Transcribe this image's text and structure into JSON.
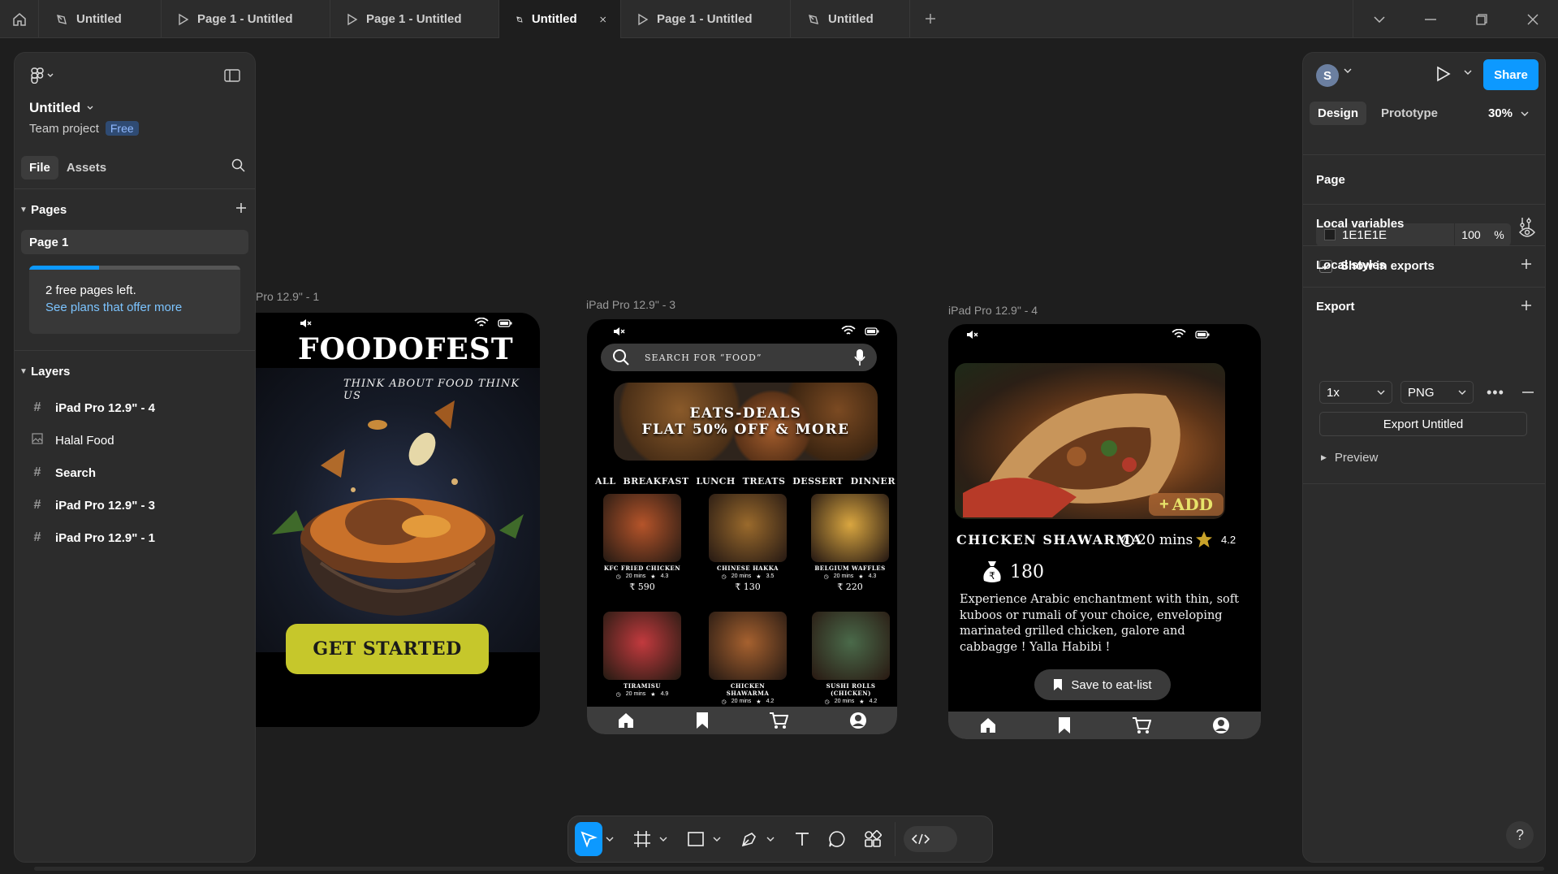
{
  "tabs": [
    {
      "label": "Untitled",
      "kind": "design",
      "active": false
    },
    {
      "label": "Page 1 - Untitled",
      "kind": "prototype",
      "active": false
    },
    {
      "label": "Page 1 - Untitled",
      "kind": "prototype",
      "active": false
    },
    {
      "label": "Untitled",
      "kind": "design",
      "active": true
    },
    {
      "label": "Page 1 - Untitled",
      "kind": "prototype",
      "active": false
    },
    {
      "label": "Untitled",
      "kind": "design",
      "active": false
    }
  ],
  "left_panel": {
    "file_title": "Untitled",
    "team": "Team project",
    "plan_badge": "Free",
    "tab_file": "File",
    "tab_assets": "Assets",
    "pages_heading": "Pages",
    "pages": [
      "Page 1"
    ],
    "upsell_line1": "2 free pages left.",
    "upsell_line2": "See plans that offer more",
    "upsell_progress": 0.33,
    "layers_heading": "Layers",
    "layers": [
      {
        "name": "iPad Pro 12.9\" - 4",
        "icon": "frame-icon"
      },
      {
        "name": "Halal Food",
        "icon": "image-icon"
      },
      {
        "name": "Search",
        "icon": "frame-icon"
      },
      {
        "name": "iPad Pro 12.9\" - 3",
        "icon": "frame-icon"
      },
      {
        "name": "iPad Pro 12.9\" - 1",
        "icon": "frame-icon"
      }
    ]
  },
  "right_panel": {
    "avatar_initial": "S",
    "share": "Share",
    "tab_design": "Design",
    "tab_prototype": "Prototype",
    "zoom": "30%",
    "page_heading": "Page",
    "page_color": "1E1E1E",
    "page_opacity": "100",
    "opacity_unit": "%",
    "show_in_exports": "Show in exports",
    "local_variables": "Local variables",
    "local_styles": "Local styles",
    "export_heading": "Export",
    "export_scale": "1x",
    "export_format": "PNG",
    "export_button": "Export Untitled",
    "preview": "Preview"
  },
  "canvas": {
    "frame1_label": "Pro 12.9\" - 1",
    "frame3_label": "iPad Pro 12.9\" - 3",
    "frame4_label": "iPad Pro 12.9\" - 4",
    "frame1": {
      "title": "FOODOFEST",
      "tagline": "THINK ABOUT FOOD THINK US",
      "cta": "GET STARTED"
    },
    "frame3": {
      "search_placeholder": "SEARCH FOR “FOOD”",
      "banner_line1": "EATS-DEALS",
      "banner_line2": "FLAT 50% OFF & MORE",
      "categories": [
        "ALL",
        "BREAKFAST",
        "LUNCH",
        "TREATS",
        "DESSERT",
        "DINNER"
      ],
      "items": [
        {
          "name": "KFC FRIED CHICKEN",
          "time": "20 mins",
          "rating": "4.3",
          "price": "590",
          "color": "#b5542a"
        },
        {
          "name": "CHINESE HAKKA",
          "time": "20 mins",
          "rating": "3.5",
          "price": "130",
          "color": "#9a6a2c"
        },
        {
          "name": "BELGIUM WAFFLES",
          "time": "20 mins",
          "rating": "4.3",
          "price": "220",
          "color": "#d9a640"
        },
        {
          "name": "TIRAMISU",
          "time": "20 mins",
          "rating": "4.9",
          "price": "",
          "color": "#c23a3e"
        },
        {
          "name": "CHICKEN SHAWARMA",
          "time": "20 mins",
          "rating": "4.2",
          "price": "",
          "color": "#a6612f"
        },
        {
          "name": "SUSHI ROLLS (CHICKEN)",
          "time": "20 mins",
          "rating": "4.2",
          "price": "",
          "color": "#4a6a4a"
        }
      ]
    },
    "frame4": {
      "add": "ADD",
      "dish_name": "CHICKEN SHAWARMA",
      "time": "20 mins",
      "rating": "4.2",
      "price": "180",
      "description": "Experience Arabic enchantment with thin, soft kuboos or rumali of your choice, enveloping marinated grilled chicken, galore and cabbagge ! Yalla Habibi !",
      "save": "Save to eat-list"
    }
  },
  "colors": {
    "accent": "#0d99ff",
    "cta_yellow": "#c6c72b",
    "star": "#c9a32a"
  }
}
